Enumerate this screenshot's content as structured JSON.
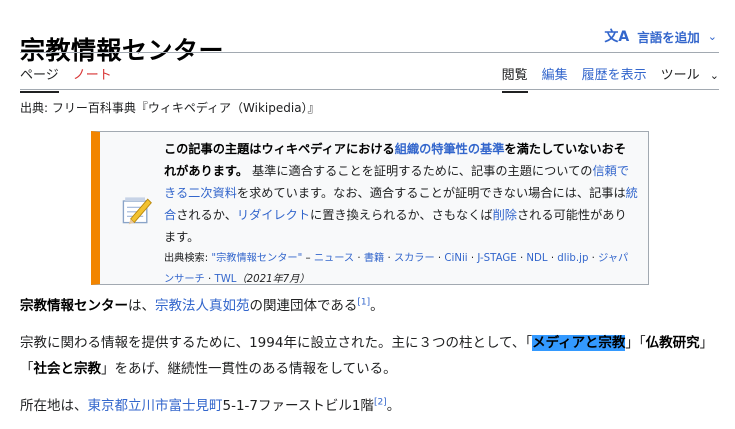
{
  "page": {
    "title": "宗教情報センター",
    "lang_button": "言語を追加"
  },
  "tabs": {
    "left": [
      "ページ",
      "ノート"
    ],
    "right": [
      "閲覧",
      "編集",
      "履歴を表示",
      "ツール"
    ]
  },
  "source_line": "出典: フリー百科事典『ウィキペディア（Wikipedia）』",
  "notice": {
    "bold_1": "この記事の主題はウィキペディアにおける",
    "link_notability": "組織の特筆性の基準",
    "bold_2": "を満たしていないおそれがあります。",
    "text_1": " 基準に適合することを証明するために、記事の主題についての",
    "link_reliable": "信頼できる二次資料",
    "text_2": "を求めています。なお、適合することが証明できない場合には、記事は",
    "link_merge": "統合",
    "text_3": "されるか、",
    "link_redirect": "リダイレクト",
    "text_4": "に置き換えられるか、さもなくば",
    "link_delete": "削除",
    "text_5": "される可能性があります。",
    "search_label": "出典検索",
    "search_colon": ": ",
    "search_query": "\"宗教情報センター\"",
    "search_dash": " – ",
    "search_links": [
      "ニュース",
      "書籍",
      "スカラー",
      "CiNii",
      "J-STAGE",
      "NDL",
      "dlib.jp",
      "ジャパンサーチ",
      "TWL"
    ],
    "sep": " · ",
    "date": "（2021年7月）"
  },
  "para1": {
    "subject": "宗教情報センター",
    "text_1": "は、",
    "link_org": "宗教法人真如苑",
    "text_2": "の関連団体である",
    "ref": "[1]",
    "text_3": "。"
  },
  "para2": {
    "text_1": "宗教に関わる情報を提供するために、1994年に設立された。主に３つの柱として、「",
    "pillar_1": "メディアと宗教",
    "text_2": "」「",
    "pillar_2": "仏教研究",
    "text_3": "」「",
    "pillar_3": "社会と宗教",
    "text_4": "」をあげ、継続性一貫性のある情報をしている。"
  },
  "para3": {
    "text_1": "所在地は、",
    "link_address": "東京都立川市富士見町",
    "text_2": "5-1-7ファーストビル1階",
    "ref": "[2]",
    "text_3": "。"
  }
}
